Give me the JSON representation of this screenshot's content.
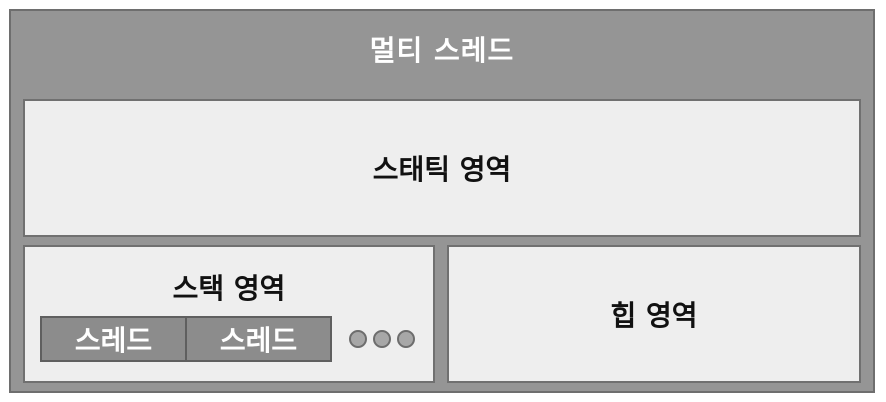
{
  "title": "멀티 스레드",
  "static_area": {
    "label": "스태틱 영역"
  },
  "stack_area": {
    "label": "스택 영역",
    "threads": [
      "스레드",
      "스레드"
    ],
    "ellipsis_dots": 3
  },
  "heap_area": {
    "label": "힙 영역"
  }
}
